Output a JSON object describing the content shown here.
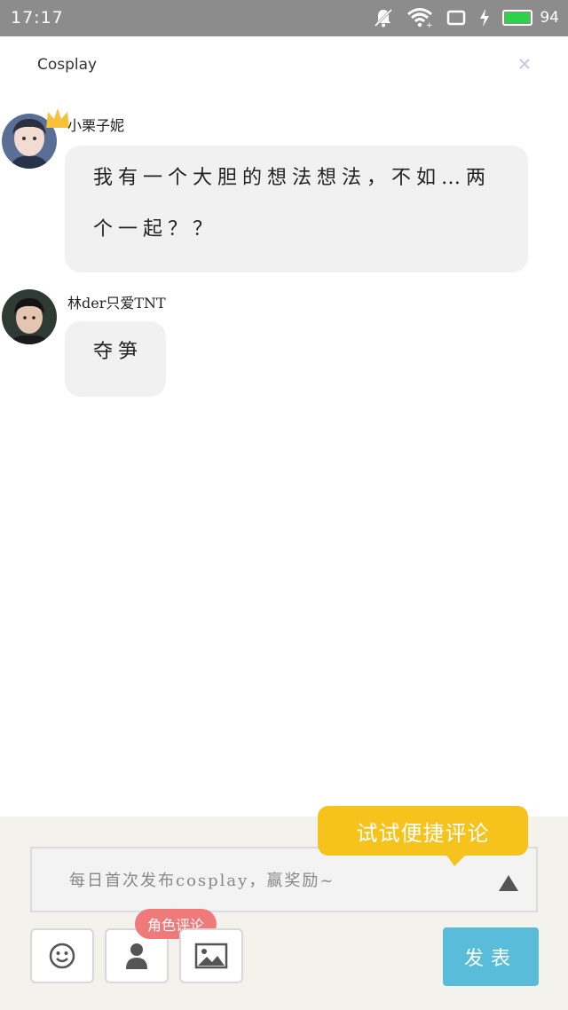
{
  "status_bar": {
    "time": "17:17",
    "battery": "94",
    "icons": [
      "notifications-off-icon",
      "wifi-icon",
      "screen-rotate-icon",
      "charging-icon",
      "battery-icon"
    ]
  },
  "header": {
    "title": "Cosplay",
    "close_icon": "close-icon"
  },
  "messages": [
    {
      "username": "小栗子妮",
      "avatar_badge": "crown-icon",
      "lines": [
        "我有一个大胆的想法想法，不如…两",
        "个一起？？"
      ]
    },
    {
      "username": "林der只爱TNT",
      "lines": [
        "夺笋"
      ]
    }
  ],
  "composer": {
    "placeholder": "每日首次发布cosplay，赢奖励~",
    "tip": "试试便捷评论",
    "role_badge": "角色评论",
    "tools": [
      "emoji-icon",
      "person-icon",
      "image-icon"
    ],
    "send_label": "发表"
  },
  "colors": {
    "status_bar": "#8c8c8c",
    "bubble": "#f1f1f1",
    "tip": "#f6c21c",
    "role_badge": "#ee7a7a",
    "send": "#59bcd8",
    "bottom_bg": "#f3f2ec"
  }
}
